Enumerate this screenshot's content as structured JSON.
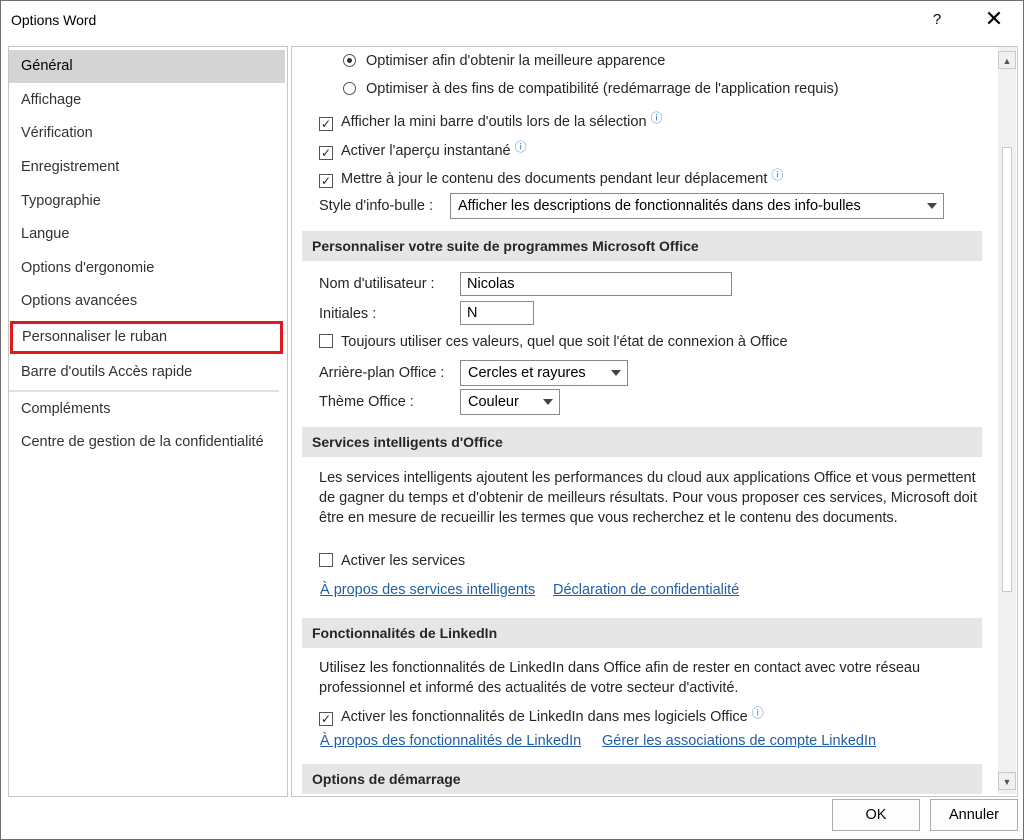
{
  "window": {
    "title": "Options Word",
    "help": "?",
    "close": "✕"
  },
  "sidebar": {
    "items": [
      {
        "label": "Général"
      },
      {
        "label": "Affichage"
      },
      {
        "label": "Vérification"
      },
      {
        "label": "Enregistrement"
      },
      {
        "label": "Typographie"
      },
      {
        "label": "Langue"
      },
      {
        "label": "Options d'ergonomie"
      },
      {
        "label": "Options avancées"
      },
      {
        "label": "Personnaliser le ruban"
      },
      {
        "label": "Barre d'outils Accès rapide"
      },
      {
        "label": "Compléments"
      },
      {
        "label": "Centre de gestion de la confidentialité"
      }
    ],
    "selected": "Général",
    "highlighted": "Personnaliser le ruban"
  },
  "display": {
    "radio_best": "Optimiser afin d'obtenir la meilleure apparence",
    "radio_compat": "Optimiser à des fins de compatibilité (redémarrage de l'application requis)",
    "mini_toolbar": "Afficher la mini barre d'outils lors de la sélection",
    "live_preview": "Activer l'aperçu instantané",
    "update_drag": "Mettre à jour le contenu des documents pendant leur déplacement",
    "tooltip_label": "Style d'info-bulle :",
    "tooltip_value": "Afficher les descriptions de fonctionnalités dans des info-bulles"
  },
  "personalize": {
    "header": "Personnaliser votre suite de programmes Microsoft Office",
    "username_label": "Nom d'utilisateur :",
    "username_value": "Nicolas",
    "initials_label": "Initiales :",
    "initials_value": "N",
    "always_use": "Toujours utiliser ces valeurs, quel que soit l'état de connexion à Office",
    "background_label": "Arrière-plan Office :",
    "background_value": "Cercles et rayures",
    "theme_label": "Thème Office :",
    "theme_value": "Couleur"
  },
  "intelligent": {
    "header": "Services intelligents d'Office",
    "description": "Les services intelligents ajoutent les performances du cloud aux applications Office et vous permettent de gagner du temps et d'obtenir de meilleurs résultats. Pour vous proposer ces services, Microsoft doit être en mesure de recueillir les termes que vous recherchez et le contenu des documents.",
    "enable": "Activer les services",
    "link_about": "À propos des services intelligents",
    "link_privacy": "Déclaration de confidentialité"
  },
  "linkedin": {
    "header": "Fonctionnalités de LinkedIn",
    "description": "Utilisez les fonctionnalités de LinkedIn dans Office afin de rester en contact avec votre réseau professionnel et informé des actualités de votre secteur d'activité.",
    "enable": "Activer les fonctionnalités de LinkedIn dans mes logiciels Office",
    "link_about": "À propos des fonctionnalités de LinkedIn",
    "link_manage": "Gérer les associations de compte LinkedIn"
  },
  "startup": {
    "header": "Options de démarrage"
  },
  "buttons": {
    "ok": "OK",
    "cancel": "Annuler"
  },
  "icons": {
    "info": "ⓘ",
    "check": "✓",
    "scroll_up": "▲",
    "scroll_down": "▼"
  },
  "colors": {
    "highlight": "#e0191f",
    "link": "#1f5fa8",
    "info": "#2b79d0",
    "selected": "#d4d4d4"
  }
}
